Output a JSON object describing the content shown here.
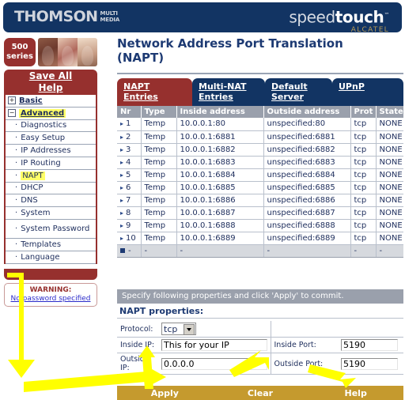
{
  "banner": {
    "brand_main": "THOMSON",
    "brand_sub_line1": "MULTI",
    "brand_sub_line2": "MEDIA",
    "product_pre": "speed",
    "product_bold": "touch",
    "product_tm": "™",
    "product_sub": "ALCATEL",
    "bg_color": "#123463"
  },
  "sidebar": {
    "badge_line1": "500",
    "badge_line2": "series",
    "save_all": "Save All",
    "help": "Help",
    "items": [
      {
        "label": "Basic",
        "level": "top",
        "marker": "+",
        "highlight": false
      },
      {
        "label": "Advanced",
        "level": "top",
        "marker": "−",
        "highlight": true
      },
      {
        "label": "Diagnostics",
        "level": "sub",
        "marker": "·",
        "highlight": false
      },
      {
        "label": "Easy Setup",
        "level": "sub",
        "marker": "·",
        "highlight": false
      },
      {
        "label": "IP Addresses",
        "level": "sub",
        "marker": "·",
        "highlight": false
      },
      {
        "label": "IP Routing",
        "level": "sub",
        "marker": "·",
        "highlight": false
      },
      {
        "label": "NAPT",
        "level": "sub",
        "marker": "·",
        "highlight": true
      },
      {
        "label": "DHCP",
        "level": "sub",
        "marker": "·",
        "highlight": false
      },
      {
        "label": "DNS",
        "level": "sub",
        "marker": "·",
        "highlight": false
      },
      {
        "label": "System",
        "level": "sub",
        "marker": "·",
        "highlight": false
      },
      {
        "label": "System Password",
        "level": "sub",
        "marker": "·",
        "highlight": false,
        "twoline": true
      },
      {
        "label": "Templates",
        "level": "sub",
        "marker": "·",
        "highlight": false
      },
      {
        "label": "Language",
        "level": "sub",
        "marker": "·",
        "highlight": false
      }
    ],
    "warning_title": "WARNING:",
    "warning_link": "No password specified",
    "accent_color": "#96302e"
  },
  "main": {
    "page_title": "Network Address Port Translation (NAPT)",
    "tabs": [
      {
        "label": "NAPT Entries",
        "active": true
      },
      {
        "label": "Multi-NAT Entries",
        "active": false
      },
      {
        "label": "Default Server",
        "active": false
      },
      {
        "label": "UPnP",
        "active": false
      }
    ],
    "table": {
      "headers": [
        "Nr",
        "Type",
        "Inside address",
        "Outside address",
        "Prot",
        "State"
      ],
      "rows": [
        {
          "nr": "1",
          "type": "Temp",
          "inside": "10.0.0.1:80",
          "outside": "unspecified:80",
          "prot": "tcp",
          "state": "NONE"
        },
        {
          "nr": "2",
          "type": "Temp",
          "inside": "10.0.0.1:6881",
          "outside": "unspecified:6881",
          "prot": "tcp",
          "state": "NONE"
        },
        {
          "nr": "3",
          "type": "Temp",
          "inside": "10.0.0.1:6882",
          "outside": "unspecified:6882",
          "prot": "tcp",
          "state": "NONE"
        },
        {
          "nr": "4",
          "type": "Temp",
          "inside": "10.0.0.1:6883",
          "outside": "unspecified:6883",
          "prot": "tcp",
          "state": "NONE"
        },
        {
          "nr": "5",
          "type": "Temp",
          "inside": "10.0.0.1:6884",
          "outside": "unspecified:6884",
          "prot": "tcp",
          "state": "NONE"
        },
        {
          "nr": "6",
          "type": "Temp",
          "inside": "10.0.0.1:6885",
          "outside": "unspecified:6885",
          "prot": "tcp",
          "state": "NONE"
        },
        {
          "nr": "7",
          "type": "Temp",
          "inside": "10.0.0.1:6886",
          "outside": "unspecified:6886",
          "prot": "tcp",
          "state": "NONE"
        },
        {
          "nr": "8",
          "type": "Temp",
          "inside": "10.0.0.1:6887",
          "outside": "unspecified:6887",
          "prot": "tcp",
          "state": "NONE"
        },
        {
          "nr": "9",
          "type": "Temp",
          "inside": "10.0.0.1:6888",
          "outside": "unspecified:6888",
          "prot": "tcp",
          "state": "NONE"
        },
        {
          "nr": "10",
          "type": "Temp",
          "inside": "10.0.0.1:6889",
          "outside": "unspecified:6889",
          "prot": "tcp",
          "state": "NONE"
        }
      ],
      "new_row": {
        "nr": "-",
        "type": "-",
        "inside": "-",
        "outside": "-",
        "prot": "-",
        "state": "-"
      }
    },
    "instruction": "Specify following properties and click 'Apply' to commit.",
    "properties_title": "NAPT properties:",
    "form": {
      "protocol_label": "Protocol:",
      "protocol_value": "tcp",
      "inside_ip_label": "Inside IP:",
      "inside_ip_value": "This for your IP",
      "inside_port_label": "Inside Port:",
      "inside_port_value": "5190",
      "outside_ip_label": "Outside IP:",
      "outside_ip_value": "0.0.0.0",
      "outside_port_label": "Outside Port:",
      "outside_port_value": "5190"
    },
    "footer_buttons": [
      "Apply",
      "Clear",
      "Help"
    ],
    "footer_color": "#c59a2e",
    "tab_active_color": "#96302e",
    "tab_inactive_color": "#123463"
  },
  "annotations": {
    "arrow_color": "#ffff00",
    "count": 3
  }
}
